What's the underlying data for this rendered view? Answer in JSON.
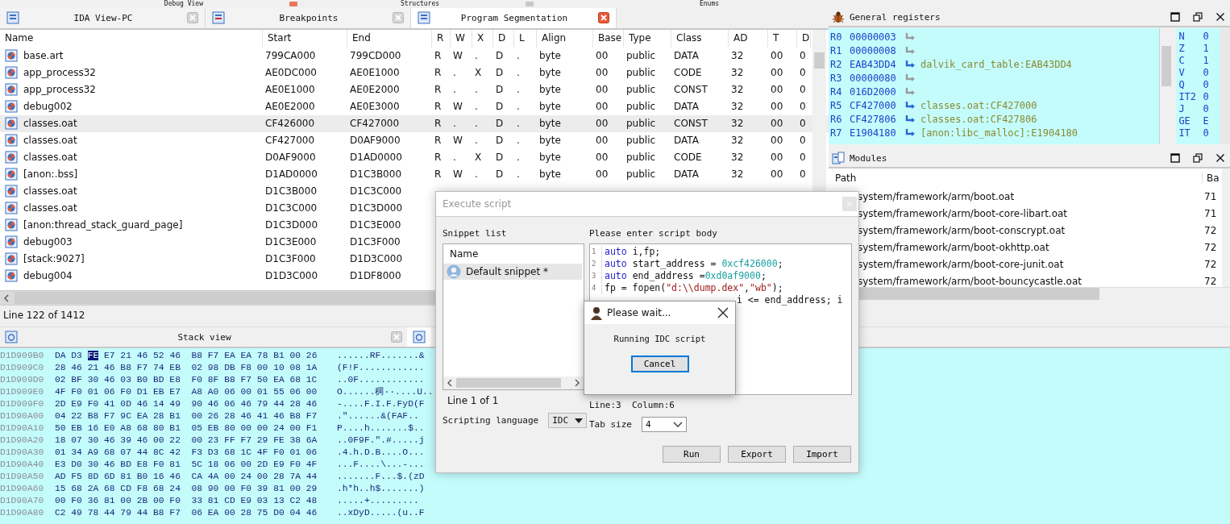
{
  "top_tabs": [
    {
      "label": "Debug View",
      "closable": true
    },
    {
      "label": "Structures",
      "closable": true
    },
    {
      "label": "Enums",
      "closable": false
    }
  ],
  "segments": {
    "tabs": [
      {
        "label": "IDA View-PC",
        "selected": false
      },
      {
        "label": "Breakpoints",
        "selected": false
      },
      {
        "label": "Program Segmentation",
        "selected": true
      }
    ],
    "columns": [
      "Name",
      "Start",
      "End",
      "R",
      "W",
      "X",
      "D",
      "L",
      "Align",
      "Base",
      "Type",
      "Class",
      "AD",
      "T",
      "D"
    ],
    "rows": [
      {
        "selected": false,
        "cells": [
          "base.art",
          "799CA000",
          "799CD000",
          "R",
          "W",
          ".",
          "D",
          ".",
          "byte",
          "00",
          "public",
          "DATA",
          "32",
          "00",
          "0"
        ]
      },
      {
        "selected": false,
        "cells": [
          "app_process32",
          "AE0DC000",
          "AE0E1000",
          "R",
          ".",
          "X",
          "D",
          ".",
          "byte",
          "00",
          "public",
          "CODE",
          "32",
          "00",
          "0"
        ]
      },
      {
        "selected": false,
        "cells": [
          "app_process32",
          "AE0E1000",
          "AE0E2000",
          "R",
          ".",
          ".",
          "D",
          ".",
          "byte",
          "00",
          "public",
          "CONST",
          "32",
          "00",
          "0"
        ]
      },
      {
        "selected": false,
        "cells": [
          "debug002",
          "AE0E2000",
          "AE0E3000",
          "R",
          "W",
          ".",
          "D",
          ".",
          "byte",
          "00",
          "public",
          "DATA",
          "32",
          "00",
          "0"
        ]
      },
      {
        "selected": true,
        "cells": [
          "classes.oat",
          "CF426000",
          "CF427000",
          "R",
          ".",
          ".",
          "D",
          ".",
          "byte",
          "00",
          "public",
          "CONST",
          "32",
          "00",
          "0"
        ]
      },
      {
        "selected": false,
        "cells": [
          "classes.oat",
          "CF427000",
          "D0AF9000",
          "R",
          "W",
          ".",
          "D",
          ".",
          "byte",
          "00",
          "public",
          "DATA",
          "32",
          "00",
          "0"
        ]
      },
      {
        "selected": false,
        "cells": [
          "classes.oat",
          "D0AF9000",
          "D1AD0000",
          "R",
          ".",
          "X",
          "D",
          ".",
          "byte",
          "00",
          "public",
          "CODE",
          "32",
          "00",
          "0"
        ]
      },
      {
        "selected": false,
        "cells": [
          "[anon:.bss]",
          "D1AD0000",
          "D1C3B000",
          "R",
          "W",
          ".",
          "D",
          ".",
          "byte",
          "00",
          "public",
          "DATA",
          "32",
          "00",
          "0"
        ]
      },
      {
        "selected": false,
        "cells": [
          "classes.oat",
          "D1C3B000",
          "D1C3C000"
        ]
      },
      {
        "selected": false,
        "cells": [
          "classes.oat",
          "D1C3C000",
          "D1C3D000"
        ]
      },
      {
        "selected": false,
        "cells": [
          "[anon:thread_stack_guard_page]",
          "D1C3D000",
          "D1C3E000"
        ]
      },
      {
        "selected": false,
        "cells": [
          "debug003",
          "D1C3E000",
          "D1C3F000"
        ]
      },
      {
        "selected": false,
        "cells": [
          "[stack:9027]",
          "D1C3F000",
          "D1D3C000"
        ]
      },
      {
        "selected": false,
        "cells": [
          "debug004",
          "D1D3C000",
          "D1DF8000"
        ]
      }
    ],
    "status": "Line 122 of 1412"
  },
  "registers": {
    "title": "General registers",
    "rows": [
      {
        "name": "R0",
        "value": "00000003"
      },
      {
        "name": "R1",
        "value": "00000008"
      },
      {
        "name": "R2",
        "value": "EAB43DD4",
        "ref": "dalvik_card_table:EAB43DD4"
      },
      {
        "name": "R3",
        "value": "00000080"
      },
      {
        "name": "R4",
        "value": "016D2000"
      },
      {
        "name": "R5",
        "value": "CF427000",
        "ref": "classes.oat:CF427000"
      },
      {
        "name": "R6",
        "value": "CF427806",
        "ref": "classes.oat:CF427806"
      },
      {
        "name": "R7",
        "value": "E1904180",
        "ref": "[anon:libc_malloc]:E1904180"
      }
    ],
    "flags": [
      {
        "name": "N",
        "value": "0"
      },
      {
        "name": "Z",
        "value": "1"
      },
      {
        "name": "C",
        "value": "1"
      },
      {
        "name": "V",
        "value": "0"
      },
      {
        "name": "Q",
        "value": "0"
      },
      {
        "name": "IT2",
        "value": "0"
      },
      {
        "name": "J",
        "value": "0"
      },
      {
        "name": "GE",
        "value": "E"
      },
      {
        "name": "IT",
        "value": "0"
      }
    ]
  },
  "modules": {
    "title": "Modules",
    "columns": [
      "Path",
      "Ba"
    ],
    "rows": [
      {
        "path": "system/framework/arm/boot.oat",
        "base": "71"
      },
      {
        "path": "system/framework/arm/boot-core-libart.oat",
        "base": "71"
      },
      {
        "path": "system/framework/arm/boot-conscrypt.oat",
        "base": "72"
      },
      {
        "path": "system/framework/arm/boot-okhttp.oat",
        "base": "72"
      },
      {
        "path": "system/framework/arm/boot-core-junit.oat",
        "base": "72"
      },
      {
        "path": "system/framework/arm/boot-bouncycastle.oat",
        "base": "72"
      }
    ]
  },
  "stack": {
    "tab": "Stack view",
    "rows": [
      {
        "address": "D1D909B0",
        "bytes": [
          {
            "text": "DA D3 ",
            "selected": false
          },
          {
            "text": "FE",
            "selected": true
          },
          {
            "text": " E7 21 46 52 46  B8 F7 EA EA 78 B1 00 26",
            "selected": false
          }
        ],
        "ascii": "......RF.......&"
      },
      {
        "address": "D1D909C0",
        "bytes": [
          {
            "text": "28 46 21 46 B8 F7 74 EB  02 98 DB F8 00 10 08 1A",
            "selected": false
          }
        ],
        "ascii": "(F!F............"
      },
      {
        "address": "D1D909D0",
        "bytes": [
          {
            "text": "02 BF 30 46 03 B0 BD E8  F0 8F B8 F7 50 EA 68 1C",
            "selected": false
          }
        ],
        "ascii": "..0F............"
      },
      {
        "address": "D1D909E0",
        "bytes": [
          {
            "text": "4F F0 01 06 F0 D1 EB E7  A8 A0 06 00 01 55 06 00",
            "selected": false
          }
        ],
        "ascii": "O......稠··....U.."
      },
      {
        "address": "D1D909F0",
        "bytes": [
          {
            "text": "2D E9 F0 41 0D 46 14 49  90 46 06 46 79 44 28 46",
            "selected": false
          }
        ],
        "ascii": "-....F.I.F.FyD(F"
      },
      {
        "address": "D1D90A00",
        "bytes": [
          {
            "text": "04 22 B8 F7 9C EA 28 B1  00 26 28 46 41 46 B8 F7",
            "selected": false
          }
        ],
        "ascii": ".\"......&(FAF.."
      },
      {
        "address": "D1D90A10",
        "bytes": [
          {
            "text": "50 EB 16 E0 A8 68 80 B1  05 EB 80 00 00 24 00 F1",
            "selected": false
          }
        ],
        "ascii": "P....h.......$.."
      },
      {
        "address": "D1D90A20",
        "bytes": [
          {
            "text": "18 07 30 46 39 46 00 22  00 23 FF F7 29 FE 38 6A",
            "selected": false
          }
        ],
        "ascii": "..0F9F.\".#.....j"
      },
      {
        "address": "D1D90A30",
        "bytes": [
          {
            "text": "01 34 A9 68 07 44 8C 42  F3 D3 68 1C 4F F0 01 06",
            "selected": false
          }
        ],
        "ascii": ".4.h.D.B....O..."
      },
      {
        "address": "D1D90A40",
        "bytes": [
          {
            "text": "E3 D0 30 46 BD E8 F0 81  5C 18 06 00 2D E9 F0 4F",
            "selected": false
          }
        ],
        "ascii": "...F....\\...-..."
      },
      {
        "address": "D1D90A50",
        "bytes": [
          {
            "text": "AD F5 8D 6D 81 B0 16 46  CA 4A 00 24 00 28 7A 44",
            "selected": false
          }
        ],
        "ascii": ".......F...$.(zD"
      },
      {
        "address": "D1D90A60",
        "bytes": [
          {
            "text": "15 68 2A 68 CD F8 68 24  08 90 00 F0 39 81 00 29",
            "selected": false
          }
        ],
        "ascii": ".h*h..h$.......)"
      },
      {
        "address": "D1D90A70",
        "bytes": [
          {
            "text": "00 F0 36 81 00 2B 00 F0  33 81 CD E9 03 13 C2 48",
            "selected": false
          }
        ],
        "ascii": ".....+........."
      },
      {
        "address": "D1D90A80",
        "bytes": [
          {
            "text": "C2 49 78 44 79 44 B8 F7  06 EA 00 28 75 D0 04 46",
            "selected": false
          }
        ],
        "ascii": "..xDyD.....(u..F"
      }
    ]
  },
  "execute_dialog": {
    "title": "Execute script",
    "snippet_label": "Snippet list",
    "snippet_column": "Name",
    "snippets": [
      {
        "name": "Default snippet *",
        "selected": true
      }
    ],
    "snippet_status": "Line 1 of 1",
    "language_label": "Scripting language",
    "language": "IDC",
    "body_label": "Please enter script body",
    "code": [
      {
        "number": "1",
        "tokens": [
          {
            "kind": "keyword",
            "text": "auto"
          },
          {
            "kind": "plain",
            "text": " i,fp;"
          }
        ]
      },
      {
        "number": "2",
        "tokens": [
          {
            "kind": "keyword",
            "text": "auto"
          },
          {
            "kind": "plain",
            "text": " start_address = "
          },
          {
            "kind": "number",
            "text": "0xcf426000"
          },
          {
            "kind": "plain",
            "text": ";"
          }
        ]
      },
      {
        "number": "3",
        "tokens": [
          {
            "kind": "keyword",
            "text": "auto"
          },
          {
            "kind": "plain",
            "text": " end_address ="
          },
          {
            "kind": "number",
            "text": "0xd0af9000"
          },
          {
            "kind": "plain",
            "text": ";"
          }
        ]
      },
      {
        "number": "4",
        "tokens": [
          {
            "kind": "plain",
            "text": "fp = fopen("
          },
          {
            "kind": "string",
            "text": "\"d:\\\\dump.dex\""
          },
          {
            "kind": "plain",
            "text": ","
          },
          {
            "kind": "string",
            "text": "\"wb\""
          },
          {
            "kind": "plain",
            "text": ");"
          }
        ]
      },
      {
        "tokens": [
          {
            "kind": "plain",
            "text": "i <= end_address; i"
          }
        ]
      }
    ],
    "cursor": "Line:3  Column:6",
    "tab_label": "Tab size",
    "tab_size": "4",
    "buttons": [
      "Run",
      "Export",
      "Import"
    ]
  },
  "wait_dialog": {
    "title": "Please wait...",
    "message": "Running IDC script",
    "button": "Cancel"
  }
}
